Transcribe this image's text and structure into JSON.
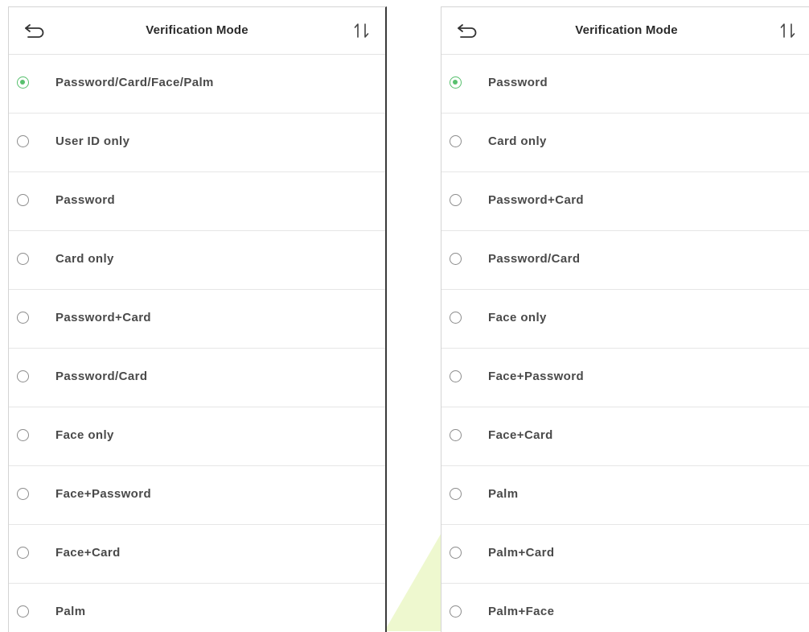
{
  "accent_color": "#58c06e",
  "left_screen": {
    "title": "Verification Mode",
    "back_icon": "back-arrow-icon",
    "sort_icon": "sort-icon",
    "selected_index": 0,
    "items": [
      {
        "label": "Password/Card/Face/Palm"
      },
      {
        "label": "User ID only"
      },
      {
        "label": "Password"
      },
      {
        "label": "Card only"
      },
      {
        "label": "Password+Card"
      },
      {
        "label": "Password/Card"
      },
      {
        "label": "Face only"
      },
      {
        "label": "Face+Password"
      },
      {
        "label": "Face+Card"
      },
      {
        "label": "Palm"
      }
    ]
  },
  "right_screen": {
    "title": "Verification Mode",
    "back_icon": "back-arrow-icon",
    "sort_icon": "sort-icon",
    "selected_index": 0,
    "items": [
      {
        "label": "Password"
      },
      {
        "label": "Card only"
      },
      {
        "label": "Password+Card"
      },
      {
        "label": "Password/Card"
      },
      {
        "label": "Face only"
      },
      {
        "label": "Face+Password"
      },
      {
        "label": "Face+Card"
      },
      {
        "label": "Palm"
      },
      {
        "label": "Palm+Card"
      },
      {
        "label": "Palm+Face"
      }
    ]
  }
}
